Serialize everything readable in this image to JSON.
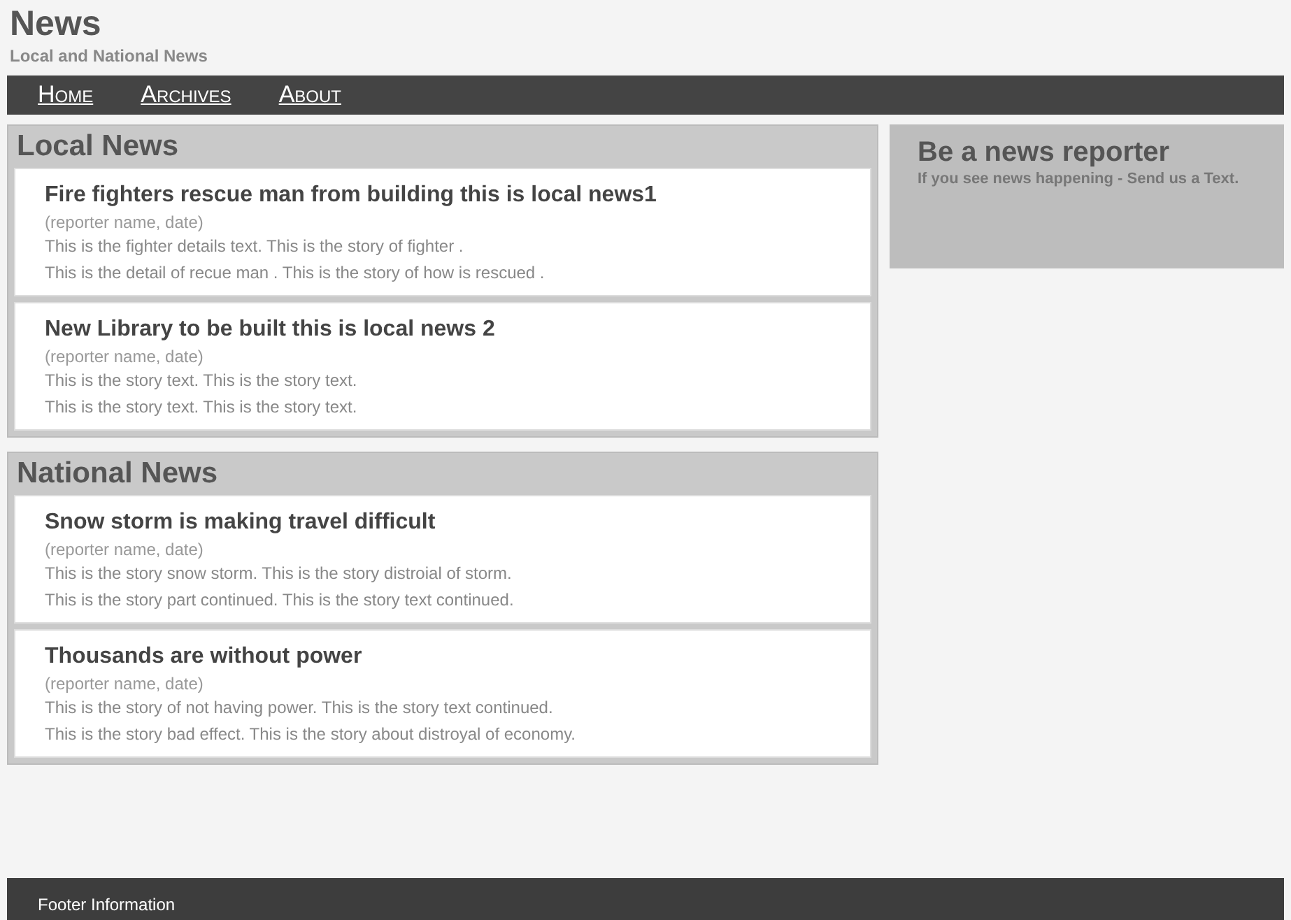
{
  "site": {
    "title": "News",
    "tagline": "Local and National News"
  },
  "nav": [
    {
      "label": "Home"
    },
    {
      "label": "Archives"
    },
    {
      "label": "About"
    }
  ],
  "sections": [
    {
      "title": "Local News",
      "articles": [
        {
          "headline": "Fire fighters rescue man from building this is local news1",
          "byline": "(reporter name, date)",
          "lines": [
            "This is the fighter details text. This is the story of fighter .",
            "This is the detail of recue man . This is the story of how is rescued ."
          ]
        },
        {
          "headline": "New Library to be built this is local news 2",
          "byline": "(reporter name, date)",
          "lines": [
            "This is the story text. This is the story text.",
            "This is the story text. This is the story text."
          ]
        }
      ]
    },
    {
      "title": "National News",
      "articles": [
        {
          "headline": "Snow storm is making travel difficult",
          "byline": "(reporter name, date)",
          "lines": [
            "This is the story snow storm. This is the story distroial of storm.",
            "This is the story part continued. This is the story text continued."
          ]
        },
        {
          "headline": "Thousands are without power",
          "byline": "(reporter name, date)",
          "lines": [
            "This is the story of not having power. This is the story text continued.",
            "This is the story bad effect. This is the story about distroyal of economy."
          ]
        }
      ]
    }
  ],
  "sidebar": {
    "title": "Be a news reporter",
    "text": "If you see news happening - Send us a Text."
  },
  "footer": "Footer Information"
}
